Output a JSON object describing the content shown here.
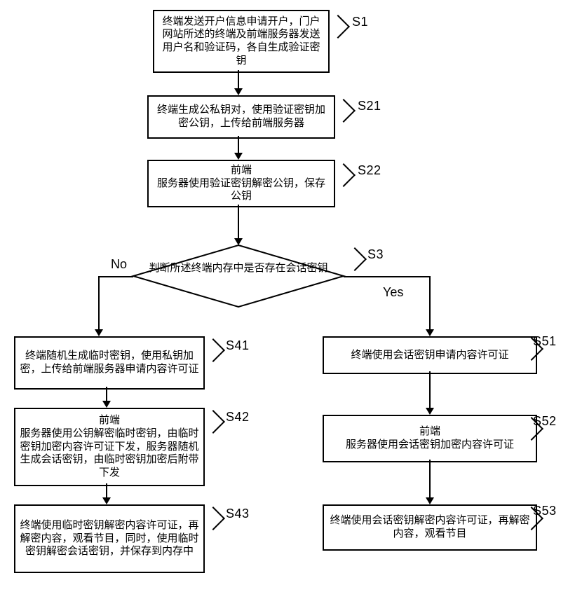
{
  "chart_data": {
    "type": "diagram",
    "title": "",
    "flow": [
      {
        "id": "S1",
        "type": "process",
        "text": "终端发送开户信息申请开户，门户网站所述的终端及前端服务器发送用户名和验证码，各自生成验证密钥"
      },
      {
        "id": "S21",
        "type": "process",
        "text": "终端生成公私钥对，使用验证密钥加密公钥，上传给前端服务器"
      },
      {
        "id": "S22",
        "type": "process",
        "text": "前端服务器使用验证密钥解密公钥，保存公钥"
      },
      {
        "id": "S3",
        "type": "decision",
        "text": "判断所述终端内存中是否存在会话密钥"
      },
      {
        "id": "S41",
        "type": "process",
        "branch": "No",
        "text": "终端随机生成临时密钥，使用私钥加密，上传给前端服务器申请内容许可证"
      },
      {
        "id": "S42",
        "type": "process",
        "branch": "No",
        "text": "前端服务器使用公钥解密临时密钥，由临时密钥加密内容许可证下发，服务器随机生成会话密钥，由临时密钥加密后附带下发"
      },
      {
        "id": "S43",
        "type": "process",
        "branch": "No",
        "text": "终端使用临时密钥解密内容许可证，再解密内容，观看节目，同时，使用临时密钥解密会话密钥，并保存到内存中"
      },
      {
        "id": "S51",
        "type": "process",
        "branch": "Yes",
        "text": "终端使用会话密钥申请内容许可证"
      },
      {
        "id": "S52",
        "type": "process",
        "branch": "Yes",
        "text": "前端服务器使用会话密钥加密内容许可证"
      },
      {
        "id": "S53",
        "type": "process",
        "branch": "Yes",
        "text": "终端使用会话密钥解密内容许可证，再解密内容，观看节目"
      }
    ],
    "edges": [
      {
        "from": "S1",
        "to": "S21"
      },
      {
        "from": "S21",
        "to": "S22"
      },
      {
        "from": "S22",
        "to": "S3"
      },
      {
        "from": "S3",
        "to": "S41",
        "label": "No"
      },
      {
        "from": "S3",
        "to": "S51",
        "label": "Yes"
      },
      {
        "from": "S41",
        "to": "S42"
      },
      {
        "from": "S42",
        "to": "S43"
      },
      {
        "from": "S51",
        "to": "S52"
      },
      {
        "from": "S52",
        "to": "S53"
      }
    ]
  },
  "nodes": {
    "s1": {
      "label": "S1",
      "text": "终端发送开户信息申请开户，门户网站所述的终端及前端服务器发送用户名和验证码，各自生成验证密钥"
    },
    "s21": {
      "label": "S21",
      "text": "终端生成公私钥对，使用验证密钥加密公钥，上传给前端服务器"
    },
    "s22": {
      "label": "S22",
      "text": "前端\n服务器使用验证密钥解密公钥，保存公钥"
    },
    "s3": {
      "label": "S3",
      "text": "判断所述终端内存中是否存在会话密钥"
    },
    "s41": {
      "label": "S41",
      "text": "终端随机生成临时密钥，使用私钥加密，上传给前端服务器申请内容许可证"
    },
    "s42": {
      "label": "S42",
      "text": "前端\n服务器使用公钥解密临时密钥，由临时密钥加密内容许可证下发，服务器随机生成会话密钥，由临时密钥加密后附带下发"
    },
    "s43": {
      "label": "S43",
      "text": "终端使用临时密钥解密内容许可证，再解密内容，观看节目，同时，使用临时密钥解密会话密钥，并保存到内存中"
    },
    "s51": {
      "label": "S51",
      "text": "终端使用会话密钥申请内容许可证"
    },
    "s52": {
      "label": "S52",
      "text": "前端\n服务器使用会话密钥加密内容许可证"
    },
    "s53": {
      "label": "S53",
      "text": "终端使用会话密钥解密内容许可证，再解密内容，观看节目"
    }
  },
  "labels": {
    "no": "No",
    "yes": "Yes"
  }
}
